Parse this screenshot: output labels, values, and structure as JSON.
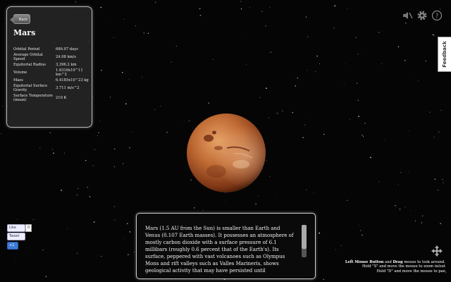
{
  "info_panel": {
    "back_label": "Back",
    "title": "Mars",
    "properties": [
      {
        "label": "Orbital Period",
        "value": "686.97 days"
      },
      {
        "label": "Average Orbital Speed",
        "value": "24.08 km/s"
      },
      {
        "label": "Equitorial Radius",
        "value": "3,396.2 km"
      },
      {
        "label": "Volume",
        "value": "1.6318x10^11 km^3"
      },
      {
        "label": "Mass",
        "value": "6.4185x10^23 kg"
      },
      {
        "label": "Equitorial Surface Gravity",
        "value": "3.711 m/s^2"
      },
      {
        "label": "Surface Temperature (mean)",
        "value": "210 K"
      }
    ]
  },
  "toolbar": {
    "icons": [
      "speaker-muted-icon",
      "gear-icon",
      "help-icon"
    ]
  },
  "feedback": {
    "label": "Feedback"
  },
  "social": {
    "like_label": "Like",
    "like_count": "0",
    "tweet_label": "Tweet",
    "plusone_label": "+1"
  },
  "description": {
    "text": "Mars (1.5 AU from the Sun) is smaller than Earth and Venus (0.107 Earth masses). It possesses an atmosphere of mostly carbon dioxide with a surface pressure of 6.1 millibars (roughly 0.6 percent that of the Earth's). Its surface, peppered with vast volcanoes such as Olympus Mons and rift valleys such as Valles Marineris, shows geological activity that may have persisted until"
  },
  "help": {
    "line1_bold1": "Left Mouse Button",
    "line1_mid": " and ",
    "line1_bold2": "Drag",
    "line1_rest": " mouse to look around.",
    "line2": "Hold \"S\" and move the mouse to zoom in/out",
    "line3": "Hold \"D\" and move the mouse to pan"
  },
  "colors": {
    "background": "#050505",
    "planet_base": "#b8582a",
    "planet_highlight": "#e09a5a"
  }
}
